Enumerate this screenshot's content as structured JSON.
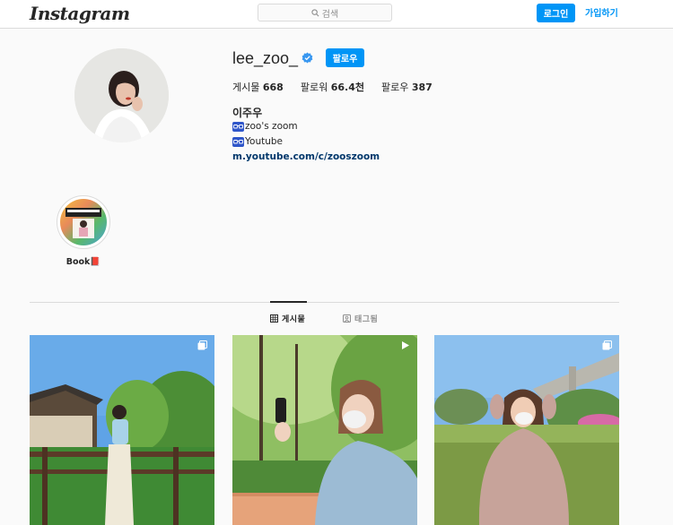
{
  "header": {
    "logo": "Instagram",
    "search_placeholder": "검색",
    "login_label": "로그인",
    "signup_label": "가입하기"
  },
  "profile": {
    "username": "lee_zoo_",
    "follow_label": "팔로우",
    "stats": [
      {
        "label": "게시물",
        "value": "668"
      },
      {
        "label": "팔로워",
        "value": "66.4천"
      },
      {
        "label": "팔로우",
        "value": "387"
      }
    ],
    "full_name": "이주우",
    "bio": [
      "zoo's zoom",
      "Youtube"
    ],
    "link": "m.youtube.com/c/zooszoom"
  },
  "highlights": [
    {
      "label": "Book📕"
    }
  ],
  "tabs": [
    {
      "label": "게시물",
      "active": true,
      "icon": "grid-icon"
    },
    {
      "label": "태그됨",
      "active": false,
      "icon": "tag-icon"
    }
  ],
  "posts": [
    {
      "type": "carousel",
      "icon": "multiple-photos-icon"
    },
    {
      "type": "video",
      "icon": "play-icon"
    },
    {
      "type": "carousel",
      "icon": "multiple-photos-icon"
    }
  ],
  "colors": {
    "accent": "#0095f6",
    "link": "#00376b",
    "border": "#dbdbdb",
    "background": "#fafafa"
  }
}
